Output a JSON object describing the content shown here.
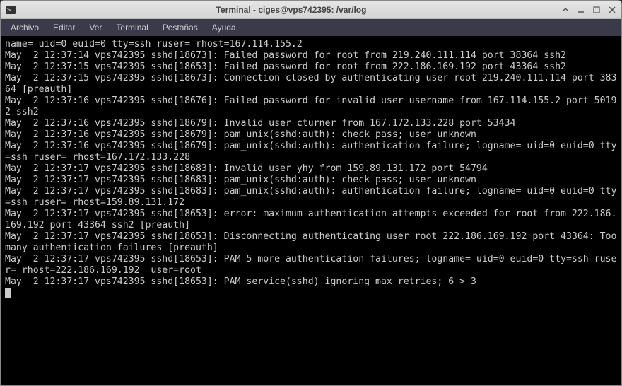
{
  "window": {
    "title": "Terminal - ciges@vps742395: /var/log"
  },
  "menu": {
    "items": [
      "Archivo",
      "Editar",
      "Ver",
      "Terminal",
      "Pestañas",
      "Ayuda"
    ]
  },
  "terminal": {
    "lines": [
      "name= uid=0 euid=0 tty=ssh ruser= rhost=167.114.155.2",
      "May  2 12:37:14 vps742395 sshd[18673]: Failed password for root from 219.240.111.114 port 38364 ssh2",
      "May  2 12:37:15 vps742395 sshd[18653]: Failed password for root from 222.186.169.192 port 43364 ssh2",
      "May  2 12:37:15 vps742395 sshd[18673]: Connection closed by authenticating user root 219.240.111.114 port 38364 [preauth]",
      "May  2 12:37:16 vps742395 sshd[18676]: Failed password for invalid user username from 167.114.155.2 port 50192 ssh2",
      "May  2 12:37:16 vps742395 sshd[18679]: Invalid user cturner from 167.172.133.228 port 53434",
      "May  2 12:37:16 vps742395 sshd[18679]: pam_unix(sshd:auth): check pass; user unknown",
      "May  2 12:37:16 vps742395 sshd[18679]: pam_unix(sshd:auth): authentication failure; logname= uid=0 euid=0 tty=ssh ruser= rhost=167.172.133.228",
      "May  2 12:37:17 vps742395 sshd[18683]: Invalid user yhy from 159.89.131.172 port 54794",
      "May  2 12:37:17 vps742395 sshd[18683]: pam_unix(sshd:auth): check pass; user unknown",
      "May  2 12:37:17 vps742395 sshd[18683]: pam_unix(sshd:auth): authentication failure; logname= uid=0 euid=0 tty=ssh ruser= rhost=159.89.131.172",
      "May  2 12:37:17 vps742395 sshd[18653]: error: maximum authentication attempts exceeded for root from 222.186.169.192 port 43364 ssh2 [preauth]",
      "May  2 12:37:17 vps742395 sshd[18653]: Disconnecting authenticating user root 222.186.169.192 port 43364: Too many authentication failures [preauth]",
      "May  2 12:37:17 vps742395 sshd[18653]: PAM 5 more authentication failures; logname= uid=0 euid=0 tty=ssh ruser= rhost=222.186.169.192  user=root",
      "May  2 12:37:17 vps742395 sshd[18653]: PAM service(sshd) ignoring max retries; 6 > 3"
    ]
  }
}
